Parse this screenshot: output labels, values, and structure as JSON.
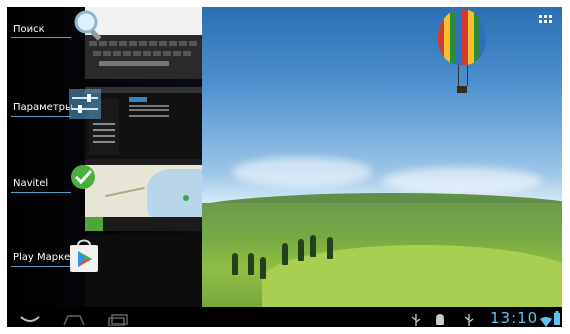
{
  "recents": {
    "items": [
      {
        "label": "Поиск",
        "icon": "search-icon"
      },
      {
        "label": "Параметры",
        "icon": "settings-sliders-icon"
      },
      {
        "label": "Navitel",
        "icon": "navitel-icon"
      },
      {
        "label": "Play Марке",
        "icon": "play-store-icon"
      }
    ]
  },
  "statusbar": {
    "time": "13:10",
    "icons": [
      "usb-icon",
      "android-debug-icon",
      "usb-icon",
      "wifi-icon",
      "battery-icon"
    ]
  },
  "navbar": {
    "buttons": [
      "back-icon",
      "home-icon",
      "recent-apps-icon"
    ]
  },
  "colors": {
    "accent": "#5ec2f2",
    "label_underline": "#5aa1c8"
  }
}
